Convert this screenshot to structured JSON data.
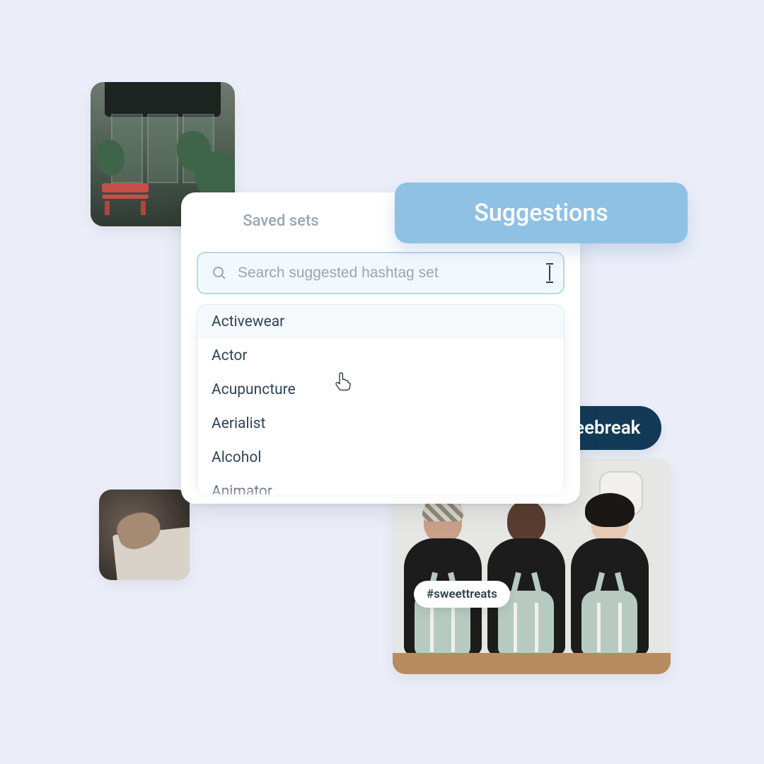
{
  "tabs": {
    "saved_label": "Saved sets",
    "suggestions_label": "Suggestions"
  },
  "search": {
    "placeholder": "Search suggested hashtag set"
  },
  "suggestions": [
    "Activewear",
    "Actor",
    "Acupuncture",
    "Aerialist",
    "Alcohol",
    "Animator"
  ],
  "hashtags": {
    "coffeebreak": "#coffeebreak",
    "sweettreats": "#sweettreats"
  }
}
